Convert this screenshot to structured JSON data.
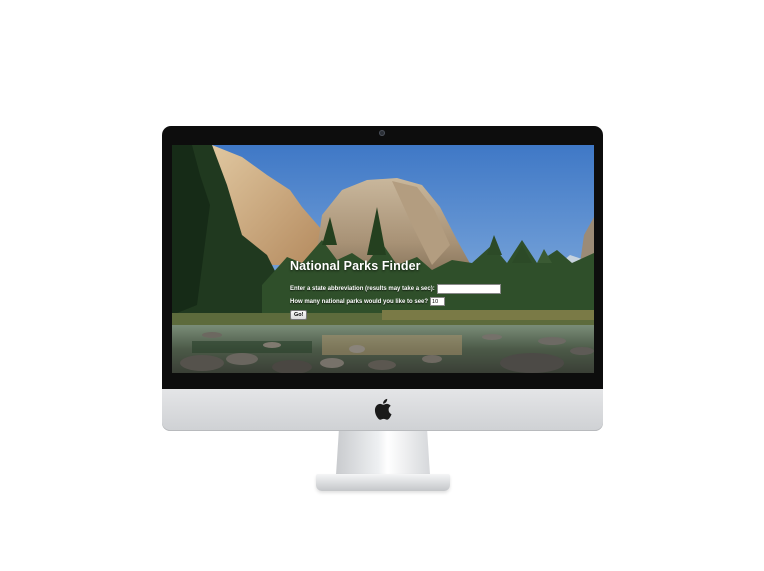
{
  "page": {
    "title": "National Parks Finder"
  },
  "form": {
    "state_label": "Enter a state abbreviation (results may take a sec):",
    "state_value": "",
    "count_label": "How many national parks would you like to see?",
    "count_value": "10",
    "go_label": "Go!"
  },
  "device": {
    "logo_icon": "apple-logo-icon",
    "bezel_color": "#0d0d0d",
    "chin_color": "#d9dadd"
  },
  "theme": {
    "sky_color": "#4f86c9",
    "text_color": "#ffffff"
  }
}
